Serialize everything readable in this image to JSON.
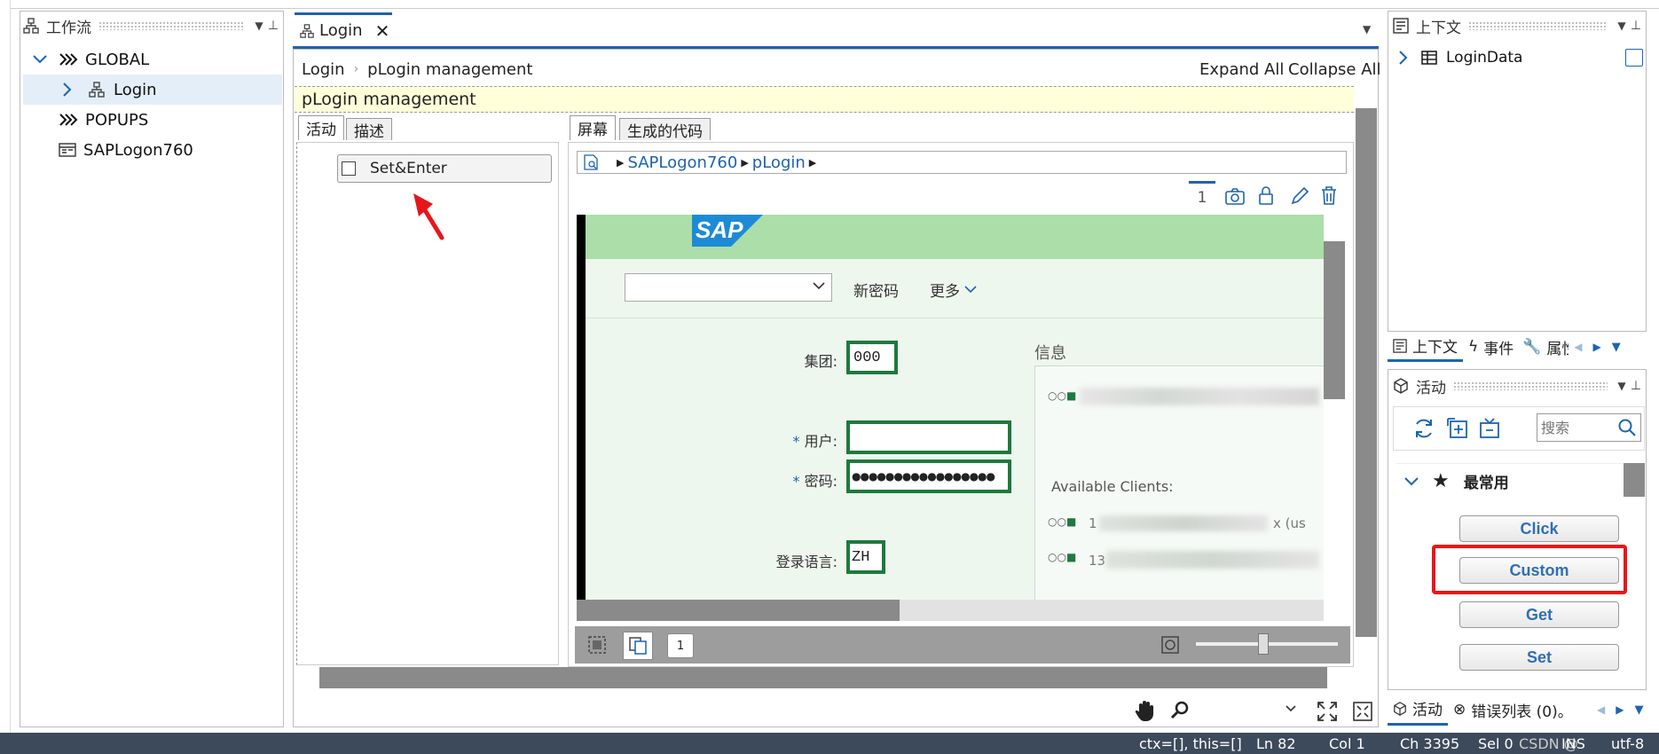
{
  "workflow_panel": {
    "title": "工作流",
    "tree": [
      {
        "label": "GLOBAL"
      },
      {
        "label": "Login"
      },
      {
        "label": "POPUPS"
      },
      {
        "label": "SAPLogon760"
      }
    ]
  },
  "editor": {
    "tab_label": "Login",
    "breadcrumb": [
      "Login",
      "pLogin management"
    ],
    "expand_all": "Expand All",
    "collapse_all": "Collapse All",
    "section_title": "pLogin management",
    "left_tabs": [
      "活动",
      "描述"
    ],
    "activity_item": "Set&Enter",
    "right_tabs": [
      "屏幕",
      "生成的代码"
    ],
    "screen_path": [
      "SAPLogon760",
      "pLogin"
    ],
    "screen_count": "1",
    "bottom_page": "1"
  },
  "sap_screen": {
    "logo": "SAP",
    "new_password": "新密码",
    "more": "更多",
    "client_label": "集团:",
    "client_value": "000",
    "user_label": "用户:",
    "password_label": "密码:",
    "password_value": "●●●●●●●●●●●●●●●●●",
    "language_label": "登录语言:",
    "language_value": "ZH",
    "info_title": "信息",
    "available_clients": "Available Clients:",
    "client_row_1": "1",
    "client_row_1_suffix": "x (us",
    "client_row_2": "13"
  },
  "context_panel": {
    "title": "上下文",
    "item": "LoginData",
    "tabs": [
      "上下文",
      "事件",
      "属性"
    ]
  },
  "activity_panel": {
    "title": "活动",
    "search_placeholder": "搜索",
    "group": "最常用",
    "buttons": [
      "Click",
      "Custom",
      "Get",
      "Set"
    ],
    "bottom_tabs": [
      "活动",
      "错误列表 (0)。"
    ]
  },
  "status_bar": {
    "ctx": "ctx=[], this=[]",
    "ln": "Ln 82",
    "col": "Col 1",
    "ch": "Ch 3395",
    "sel": "Sel 0",
    "ins": "INS",
    "encoding": "utf-8",
    "watermark": "CSDN @"
  },
  "colors": {
    "sap_green_header": "#abdea8",
    "sap_green_bg": "#eef7ee",
    "field_border": "#1d7a3c",
    "accent_blue": "#1c64b0",
    "highlight_red": "#e8151b",
    "status_bar": "#3c4a5b"
  }
}
